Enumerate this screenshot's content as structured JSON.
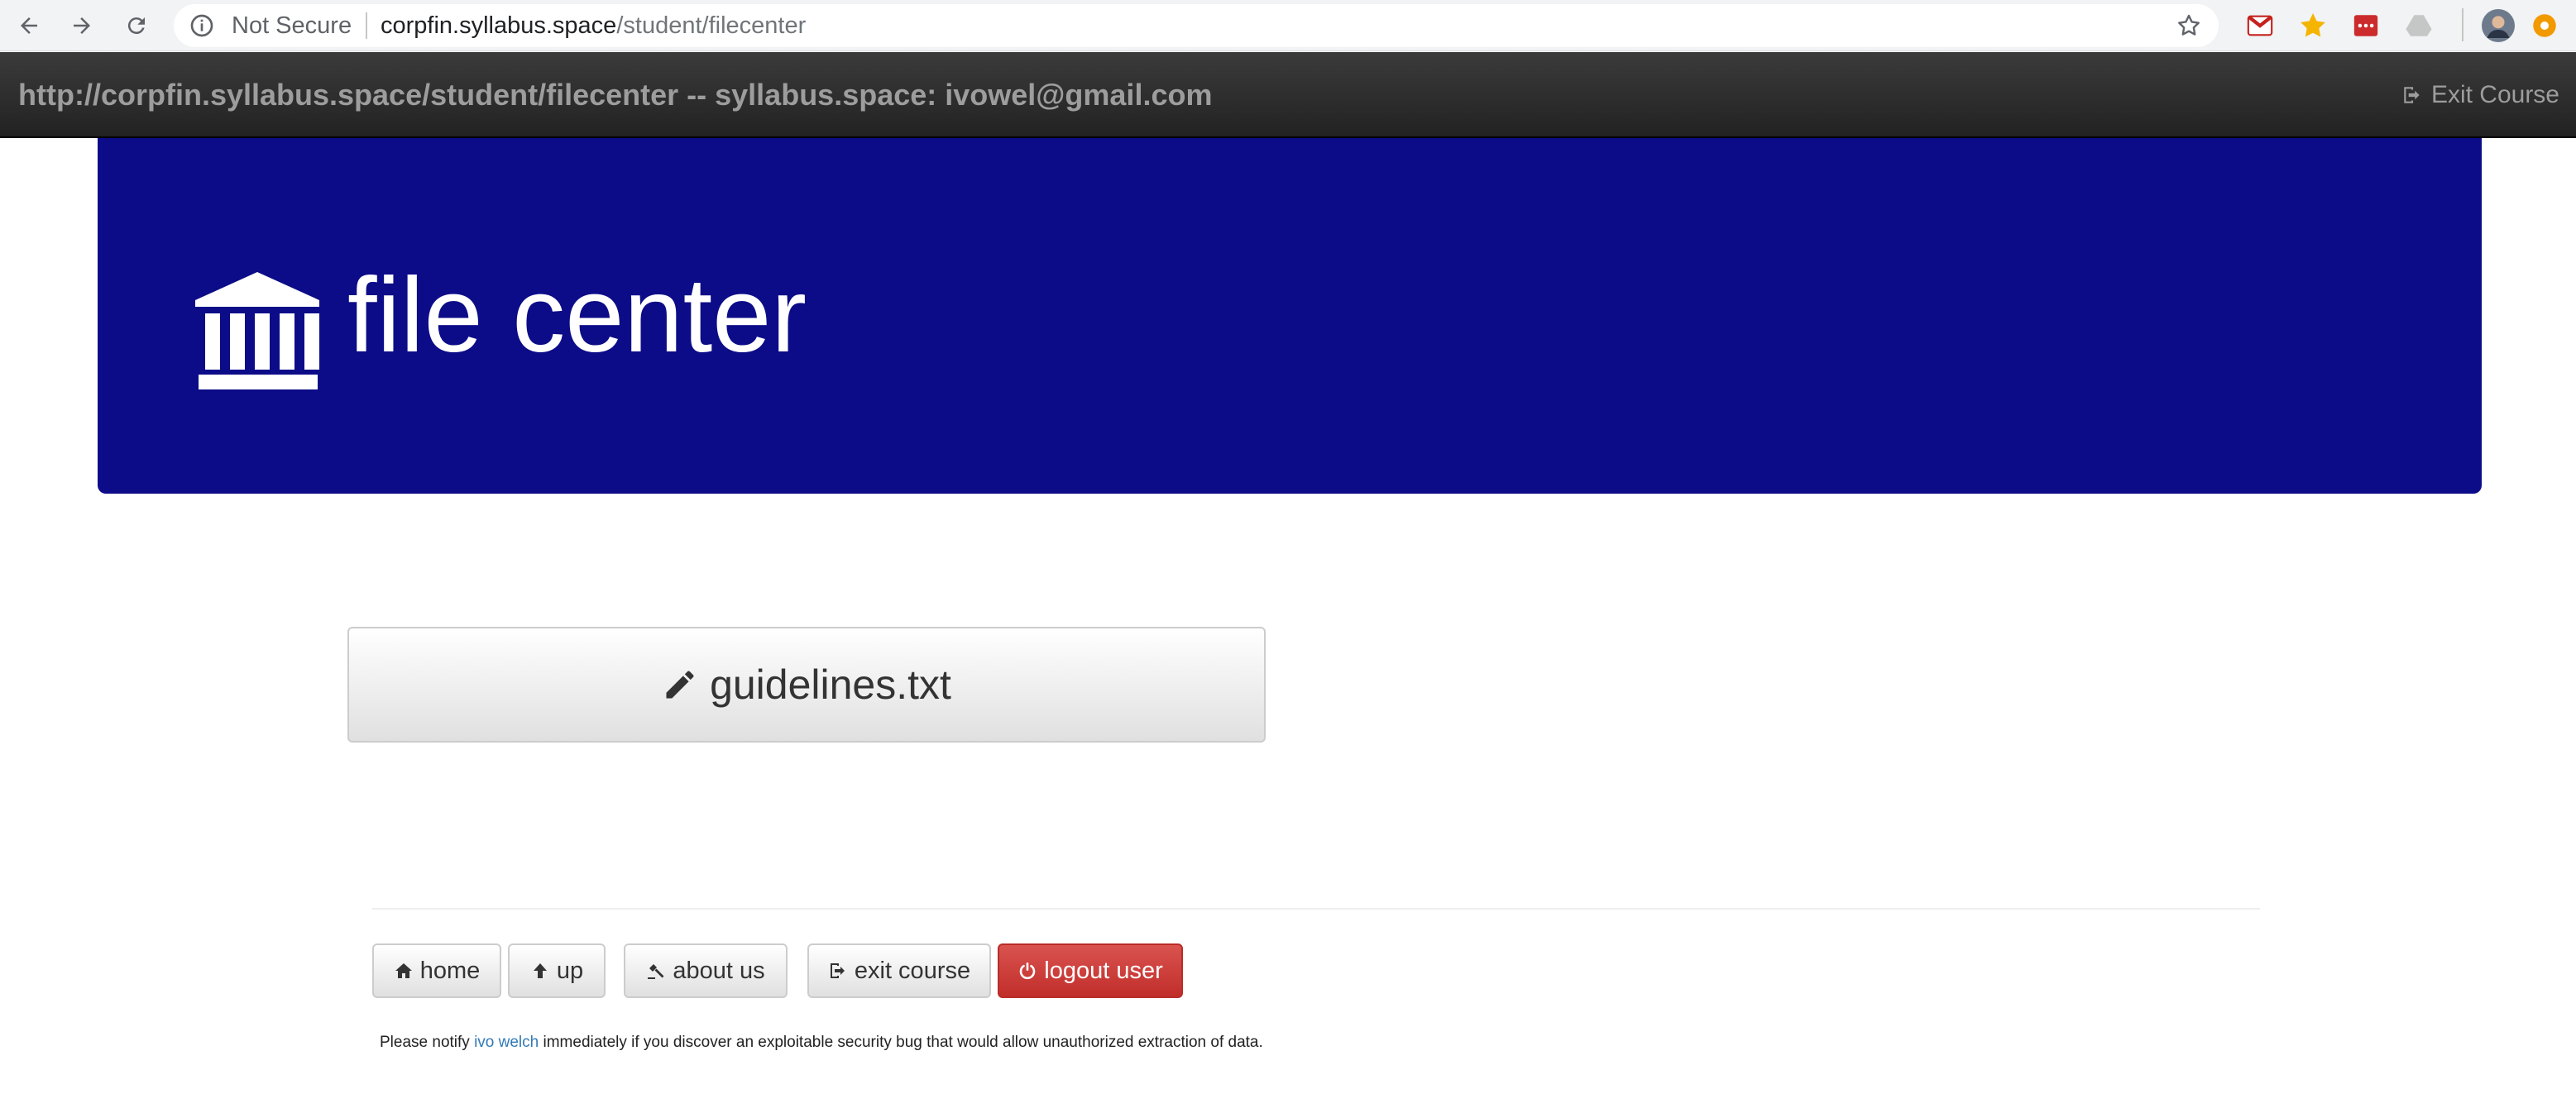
{
  "browser": {
    "security_label": "Not Secure",
    "url_domain": "corpfin.syllabus.space",
    "url_path": "/student/filecenter"
  },
  "topbar": {
    "title": "http://corpfin.syllabus.space/student/filecenter -- syllabus.space: ivowel@gmail.com",
    "exit_label": "Exit Course"
  },
  "jumbotron": {
    "title": "file center",
    "background": "#0c0c88"
  },
  "files": [
    {
      "name": "guidelines.txt",
      "icon": "pencil-icon"
    }
  ],
  "footer": {
    "buttons": {
      "home": "home",
      "up": "up",
      "about": "about us",
      "exit": "exit course",
      "logout": "logout user"
    },
    "notice_before": "Please notify ",
    "notice_link": "ivo welch",
    "notice_after": " immediately if you discover an exploitable security bug that would allow unauthorized extraction of data."
  },
  "colors": {
    "danger": "#d9534f",
    "link": "#337ab7",
    "topbar_text": "#9d9d9d"
  }
}
